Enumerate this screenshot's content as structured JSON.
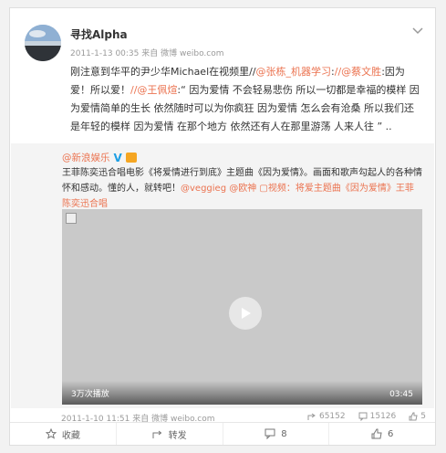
{
  "post": {
    "username": "寻找Alpha",
    "meta": "2011-1-13 00:35 来自 微博 weibo.com",
    "content": {
      "p1": "刚注意到华平的尹少华Michael在视频里//",
      "m1": "@张栋_机器学习",
      "p2": ":",
      "m2": "//@蔡文胜",
      "p3": ":因为爱！所以爱！",
      "m3": "//@王佩煊",
      "p4": ":“ 因为爱情 不会轻易悲伤 所以一切都是幸福的模样 因为爱情简单的生长 依然随时可以为你疯狂 因为爱情 怎么会有沧桑 所以我们还是年轻的模样 因为爱情 在那个地方 依然还有人在那里游荡 人来人往 ” .."
    }
  },
  "repost": {
    "author": "@新浪娱乐",
    "text_main": "王菲陈奕迅合唱电影《将爱情进行到底》主题曲《因为爱情》。画面和歌声勾起人的各种情怀和感动。懂的人，就转吧！",
    "mention1": "@veggieg",
    "mention2": "@欧神",
    "video_link": "视频：将爱主题曲《因为爱情》王菲陈奕迅合唱",
    "video": {
      "plays": "3万次播放",
      "duration": "03:45"
    },
    "footer_meta": "2011-1-10 11:51 来自 微博 weibo.com",
    "stats": {
      "reposts": "65152",
      "comments": "15126",
      "likes": "5"
    }
  },
  "actions": {
    "favorite": "收藏",
    "repost": "转发",
    "comment": "8",
    "like": "6"
  }
}
